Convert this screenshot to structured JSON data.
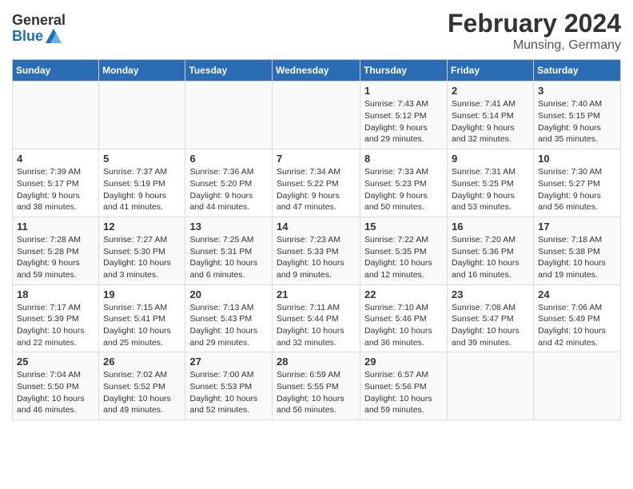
{
  "header": {
    "logo_general": "General",
    "logo_blue": "Blue",
    "month_year": "February 2024",
    "location": "Munsing, Germany"
  },
  "days_of_week": [
    "Sunday",
    "Monday",
    "Tuesday",
    "Wednesday",
    "Thursday",
    "Friday",
    "Saturday"
  ],
  "weeks": [
    [
      {
        "day": "",
        "info": ""
      },
      {
        "day": "",
        "info": ""
      },
      {
        "day": "",
        "info": ""
      },
      {
        "day": "",
        "info": ""
      },
      {
        "day": "1",
        "info": "Sunrise: 7:43 AM\nSunset: 5:12 PM\nDaylight: 9 hours\nand 29 minutes."
      },
      {
        "day": "2",
        "info": "Sunrise: 7:41 AM\nSunset: 5:14 PM\nDaylight: 9 hours\nand 32 minutes."
      },
      {
        "day": "3",
        "info": "Sunrise: 7:40 AM\nSunset: 5:15 PM\nDaylight: 9 hours\nand 35 minutes."
      }
    ],
    [
      {
        "day": "4",
        "info": "Sunrise: 7:39 AM\nSunset: 5:17 PM\nDaylight: 9 hours\nand 38 minutes."
      },
      {
        "day": "5",
        "info": "Sunrise: 7:37 AM\nSunset: 5:19 PM\nDaylight: 9 hours\nand 41 minutes."
      },
      {
        "day": "6",
        "info": "Sunrise: 7:36 AM\nSunset: 5:20 PM\nDaylight: 9 hours\nand 44 minutes."
      },
      {
        "day": "7",
        "info": "Sunrise: 7:34 AM\nSunset: 5:22 PM\nDaylight: 9 hours\nand 47 minutes."
      },
      {
        "day": "8",
        "info": "Sunrise: 7:33 AM\nSunset: 5:23 PM\nDaylight: 9 hours\nand 50 minutes."
      },
      {
        "day": "9",
        "info": "Sunrise: 7:31 AM\nSunset: 5:25 PM\nDaylight: 9 hours\nand 53 minutes."
      },
      {
        "day": "10",
        "info": "Sunrise: 7:30 AM\nSunset: 5:27 PM\nDaylight: 9 hours\nand 56 minutes."
      }
    ],
    [
      {
        "day": "11",
        "info": "Sunrise: 7:28 AM\nSunset: 5:28 PM\nDaylight: 9 hours\nand 59 minutes."
      },
      {
        "day": "12",
        "info": "Sunrise: 7:27 AM\nSunset: 5:30 PM\nDaylight: 10 hours\nand 3 minutes."
      },
      {
        "day": "13",
        "info": "Sunrise: 7:25 AM\nSunset: 5:31 PM\nDaylight: 10 hours\nand 6 minutes."
      },
      {
        "day": "14",
        "info": "Sunrise: 7:23 AM\nSunset: 5:33 PM\nDaylight: 10 hours\nand 9 minutes."
      },
      {
        "day": "15",
        "info": "Sunrise: 7:22 AM\nSunset: 5:35 PM\nDaylight: 10 hours\nand 12 minutes."
      },
      {
        "day": "16",
        "info": "Sunrise: 7:20 AM\nSunset: 5:36 PM\nDaylight: 10 hours\nand 16 minutes."
      },
      {
        "day": "17",
        "info": "Sunrise: 7:18 AM\nSunset: 5:38 PM\nDaylight: 10 hours\nand 19 minutes."
      }
    ],
    [
      {
        "day": "18",
        "info": "Sunrise: 7:17 AM\nSunset: 5:39 PM\nDaylight: 10 hours\nand 22 minutes."
      },
      {
        "day": "19",
        "info": "Sunrise: 7:15 AM\nSunset: 5:41 PM\nDaylight: 10 hours\nand 25 minutes."
      },
      {
        "day": "20",
        "info": "Sunrise: 7:13 AM\nSunset: 5:43 PM\nDaylight: 10 hours\nand 29 minutes."
      },
      {
        "day": "21",
        "info": "Sunrise: 7:11 AM\nSunset: 5:44 PM\nDaylight: 10 hours\nand 32 minutes."
      },
      {
        "day": "22",
        "info": "Sunrise: 7:10 AM\nSunset: 5:46 PM\nDaylight: 10 hours\nand 36 minutes."
      },
      {
        "day": "23",
        "info": "Sunrise: 7:08 AM\nSunset: 5:47 PM\nDaylight: 10 hours\nand 39 minutes."
      },
      {
        "day": "24",
        "info": "Sunrise: 7:06 AM\nSunset: 5:49 PM\nDaylight: 10 hours\nand 42 minutes."
      }
    ],
    [
      {
        "day": "25",
        "info": "Sunrise: 7:04 AM\nSunset: 5:50 PM\nDaylight: 10 hours\nand 46 minutes."
      },
      {
        "day": "26",
        "info": "Sunrise: 7:02 AM\nSunset: 5:52 PM\nDaylight: 10 hours\nand 49 minutes."
      },
      {
        "day": "27",
        "info": "Sunrise: 7:00 AM\nSunset: 5:53 PM\nDaylight: 10 hours\nand 52 minutes."
      },
      {
        "day": "28",
        "info": "Sunrise: 6:59 AM\nSunset: 5:55 PM\nDaylight: 10 hours\nand 56 minutes."
      },
      {
        "day": "29",
        "info": "Sunrise: 6:57 AM\nSunset: 5:56 PM\nDaylight: 10 hours\nand 59 minutes."
      },
      {
        "day": "",
        "info": ""
      },
      {
        "day": "",
        "info": ""
      }
    ]
  ]
}
